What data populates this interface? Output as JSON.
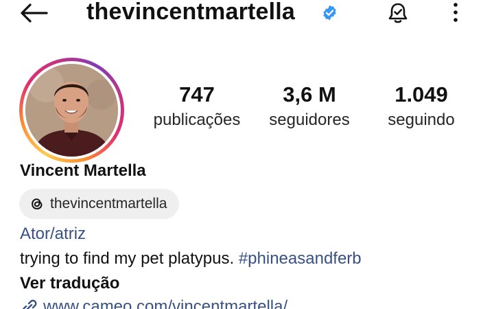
{
  "header": {
    "username": "thevincentmartella",
    "verified": true,
    "back_icon": "arrow-left-icon",
    "notification_icon": "bell-check-icon",
    "more_icon": "vertical-ellipsis-icon"
  },
  "profile": {
    "avatar_story_ring": true,
    "full_name": "Vincent Martella"
  },
  "stats": [
    {
      "value": "747",
      "label": "publicações"
    },
    {
      "value": "3,6 M",
      "label": "seguidores"
    },
    {
      "value": "1.049",
      "label": "seguindo"
    }
  ],
  "threads_badge": {
    "icon": "threads-icon",
    "handle": "thevincentmartella"
  },
  "bio": {
    "category": "Ator/atriz",
    "text": "trying to find my pet platypus. ",
    "hashtag": "#phineasandferb",
    "translate_label": "Ver tradução",
    "link_icon": "link-icon",
    "link": "www.cameo.com/vincentmartella/"
  },
  "colors": {
    "link_blue": "#385185",
    "verified_blue": "#3897f0",
    "pill_bg": "#efefef"
  }
}
